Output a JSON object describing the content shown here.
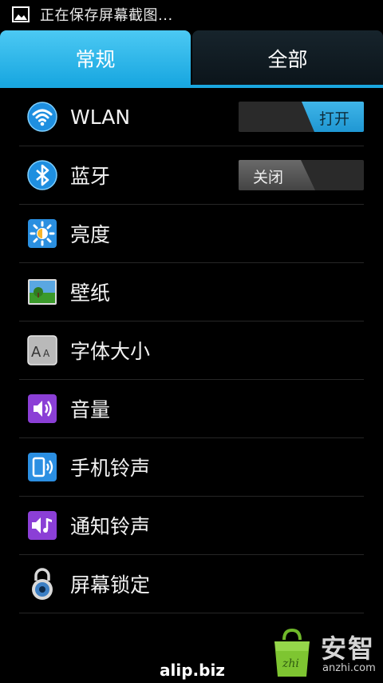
{
  "status_bar": {
    "text": "正在保存屏幕截图..."
  },
  "tabs": [
    {
      "label": "常规",
      "active": true
    },
    {
      "label": "全部",
      "active": false
    }
  ],
  "settings": [
    {
      "label": "WLAN",
      "icon": "wifi-icon",
      "switch": "打开"
    },
    {
      "label": "蓝牙",
      "icon": "bluetooth-icon",
      "switch": "关闭"
    },
    {
      "label": "亮度",
      "icon": "brightness-icon"
    },
    {
      "label": "壁纸",
      "icon": "wallpaper-icon"
    },
    {
      "label": "字体大小",
      "icon": "font-size-icon"
    },
    {
      "label": "音量",
      "icon": "volume-icon"
    },
    {
      "label": "手机铃声",
      "icon": "phone-ringtone-icon"
    },
    {
      "label": "通知铃声",
      "icon": "notification-ringtone-icon"
    },
    {
      "label": "屏幕锁定",
      "icon": "screen-lock-icon"
    }
  ],
  "watermark": {
    "brand": "安智",
    "url": "anzhi.com",
    "alip": "alip.biz"
  },
  "colors": {
    "accent": "#1aa7e0",
    "tab_active": "#2db6ec",
    "background": "#000000"
  }
}
